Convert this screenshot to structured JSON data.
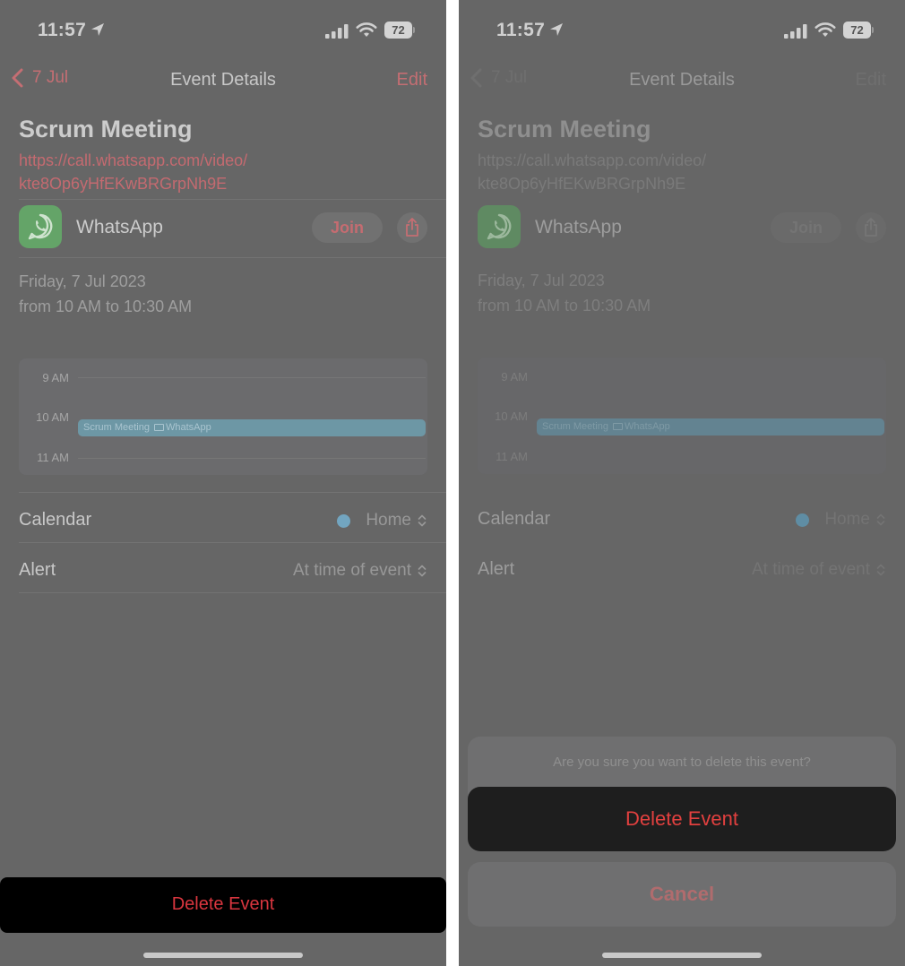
{
  "status_bar": {
    "time": "11:57",
    "battery": "72"
  },
  "nav": {
    "back_label": "7 Jul",
    "title": "Event Details",
    "edit_label": "Edit"
  },
  "event": {
    "title": "Scrum Meeting",
    "url_line1": "https://call.whatsapp.com/video/",
    "url_line2": "kte8Op6yHfEKwBRGrpNh9E",
    "app_name": "WhatsApp",
    "join_label": "Join",
    "date": "Friday, 7 Jul 2023",
    "time_range": "from 10 AM to 10:30 AM"
  },
  "day_view": {
    "hours": [
      "9 AM",
      "10 AM",
      "11 AM"
    ],
    "event_title": "Scrum Meeting",
    "event_location": "WhatsApp"
  },
  "settings": {
    "calendar_label": "Calendar",
    "calendar_value": "Home",
    "alert_label": "Alert",
    "alert_value": "At time of event"
  },
  "delete_button": "Delete Event",
  "action_sheet": {
    "message": "Are you sure you want to delete this event?",
    "delete_label": "Delete Event",
    "cancel_label": "Cancel"
  },
  "colors": {
    "destructive": "#d9363f",
    "accent": "#c46e73",
    "calendar_home": "#72a5c0",
    "whatsapp": "#64a468"
  }
}
